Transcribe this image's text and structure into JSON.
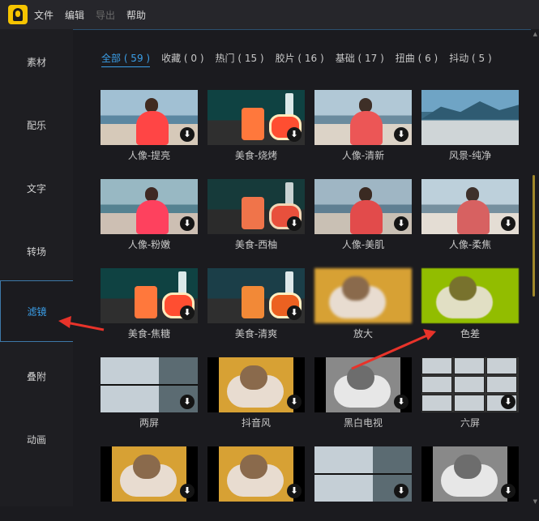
{
  "menubar": {
    "items": [
      "文件",
      "编辑",
      "导出",
      "帮助"
    ],
    "disabled_index": 2
  },
  "sidebar": {
    "items": [
      "素材",
      "配乐",
      "文字",
      "转场",
      "滤镜",
      "叠附",
      "动画"
    ],
    "active_index": 4
  },
  "tabs": {
    "items": [
      "全部 ( 59 )",
      "收藏 ( 0 )",
      "热门 ( 15 )",
      "胶片 ( 16 )",
      "基础 ( 17 )",
      "扭曲 ( 6 )",
      "抖动 ( 5 )"
    ],
    "active_index": 0
  },
  "filters": [
    {
      "label": "人像-提亮",
      "scene": "beach warm",
      "download": true
    },
    {
      "label": "美食-烧烤",
      "scene": "food warm",
      "download": true
    },
    {
      "label": "人像-清新",
      "scene": "beach fresh",
      "download": true
    },
    {
      "label": "风景-纯净",
      "scene": "mountain",
      "download": false
    },
    {
      "label": "人像-粉嫩",
      "scene": "beach pink",
      "download": true
    },
    {
      "label": "美食-西柚",
      "scene": "food",
      "download": true
    },
    {
      "label": "人像-美肌",
      "scene": "beach",
      "download": true
    },
    {
      "label": "人像-柔焦",
      "scene": "beach soft",
      "download": true
    },
    {
      "label": "美食-焦糖",
      "scene": "food warm",
      "download": true
    },
    {
      "label": "美食-清爽",
      "scene": "food cool",
      "download": true
    },
    {
      "label": "放大",
      "scene": "cat blur",
      "download": false
    },
    {
      "label": "色差",
      "scene": "cat shift",
      "download": false
    },
    {
      "label": "两屏",
      "scene": "split",
      "download": true
    },
    {
      "label": "抖音风",
      "scene": "pillar-cat",
      "download": true
    },
    {
      "label": "黑白电视",
      "scene": "pillar-bw",
      "download": true
    },
    {
      "label": "六屏",
      "scene": "six",
      "download": true
    },
    {
      "label": "",
      "scene": "pillar-cat",
      "download": true
    },
    {
      "label": "",
      "scene": "pillar-cat",
      "download": true
    },
    {
      "label": "",
      "scene": "split",
      "download": true
    },
    {
      "label": "",
      "scene": "pillar-bw",
      "download": true
    }
  ],
  "icons": {
    "download": "download-icon",
    "arrow_color": "#e8332a"
  },
  "colors": {
    "accent": "#3b9fe8",
    "logo": "#f5c400",
    "scroll_thumb": "#a0882a"
  }
}
